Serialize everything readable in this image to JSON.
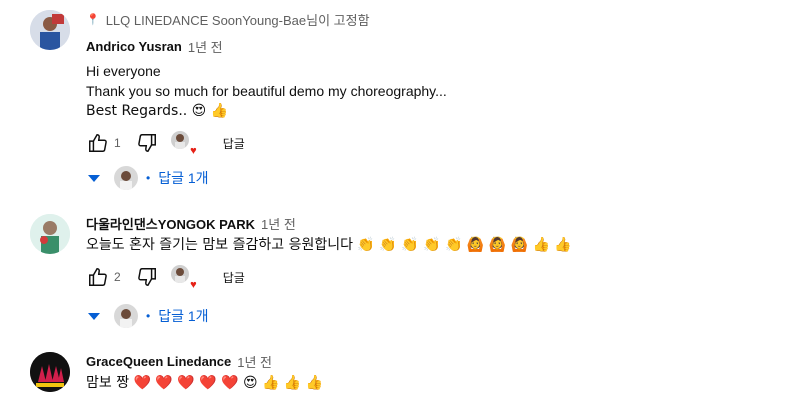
{
  "comments": [
    {
      "pinned_label": "LLQ LINEDANCE SoonYoung-Bae님이 고정함",
      "author": "Andrico Yusran",
      "time": "1년 전",
      "lines": [
        "Hi everyone",
        "Thank you so much for beautiful demo my choreography...",
        "Best Regards.. 😍 👍"
      ],
      "likes": "1",
      "reply_label": "답글",
      "replies_label": "답글 1개"
    },
    {
      "author": "다울라인댄스YONGOK PARK",
      "time": "1년 전",
      "lines": [
        "오늘도 혼자 즐기는 맘보 즐감하고 응원합니다 👏 👏 👏 👏 👏 🙆 🙆 🙆 👍 👍"
      ],
      "likes": "2",
      "reply_label": "답글",
      "replies_label": "답글 1개"
    },
    {
      "author": "GraceQueen Linedance",
      "time": "1년 전",
      "lines": [
        "맘보 짱 ❤️ ❤️ ❤️ ❤️ ❤️ 😍 👍 👍 👍"
      ]
    }
  ],
  "colors": {
    "link": "#065fd4",
    "muted": "#606060",
    "heart": "#e62117"
  }
}
